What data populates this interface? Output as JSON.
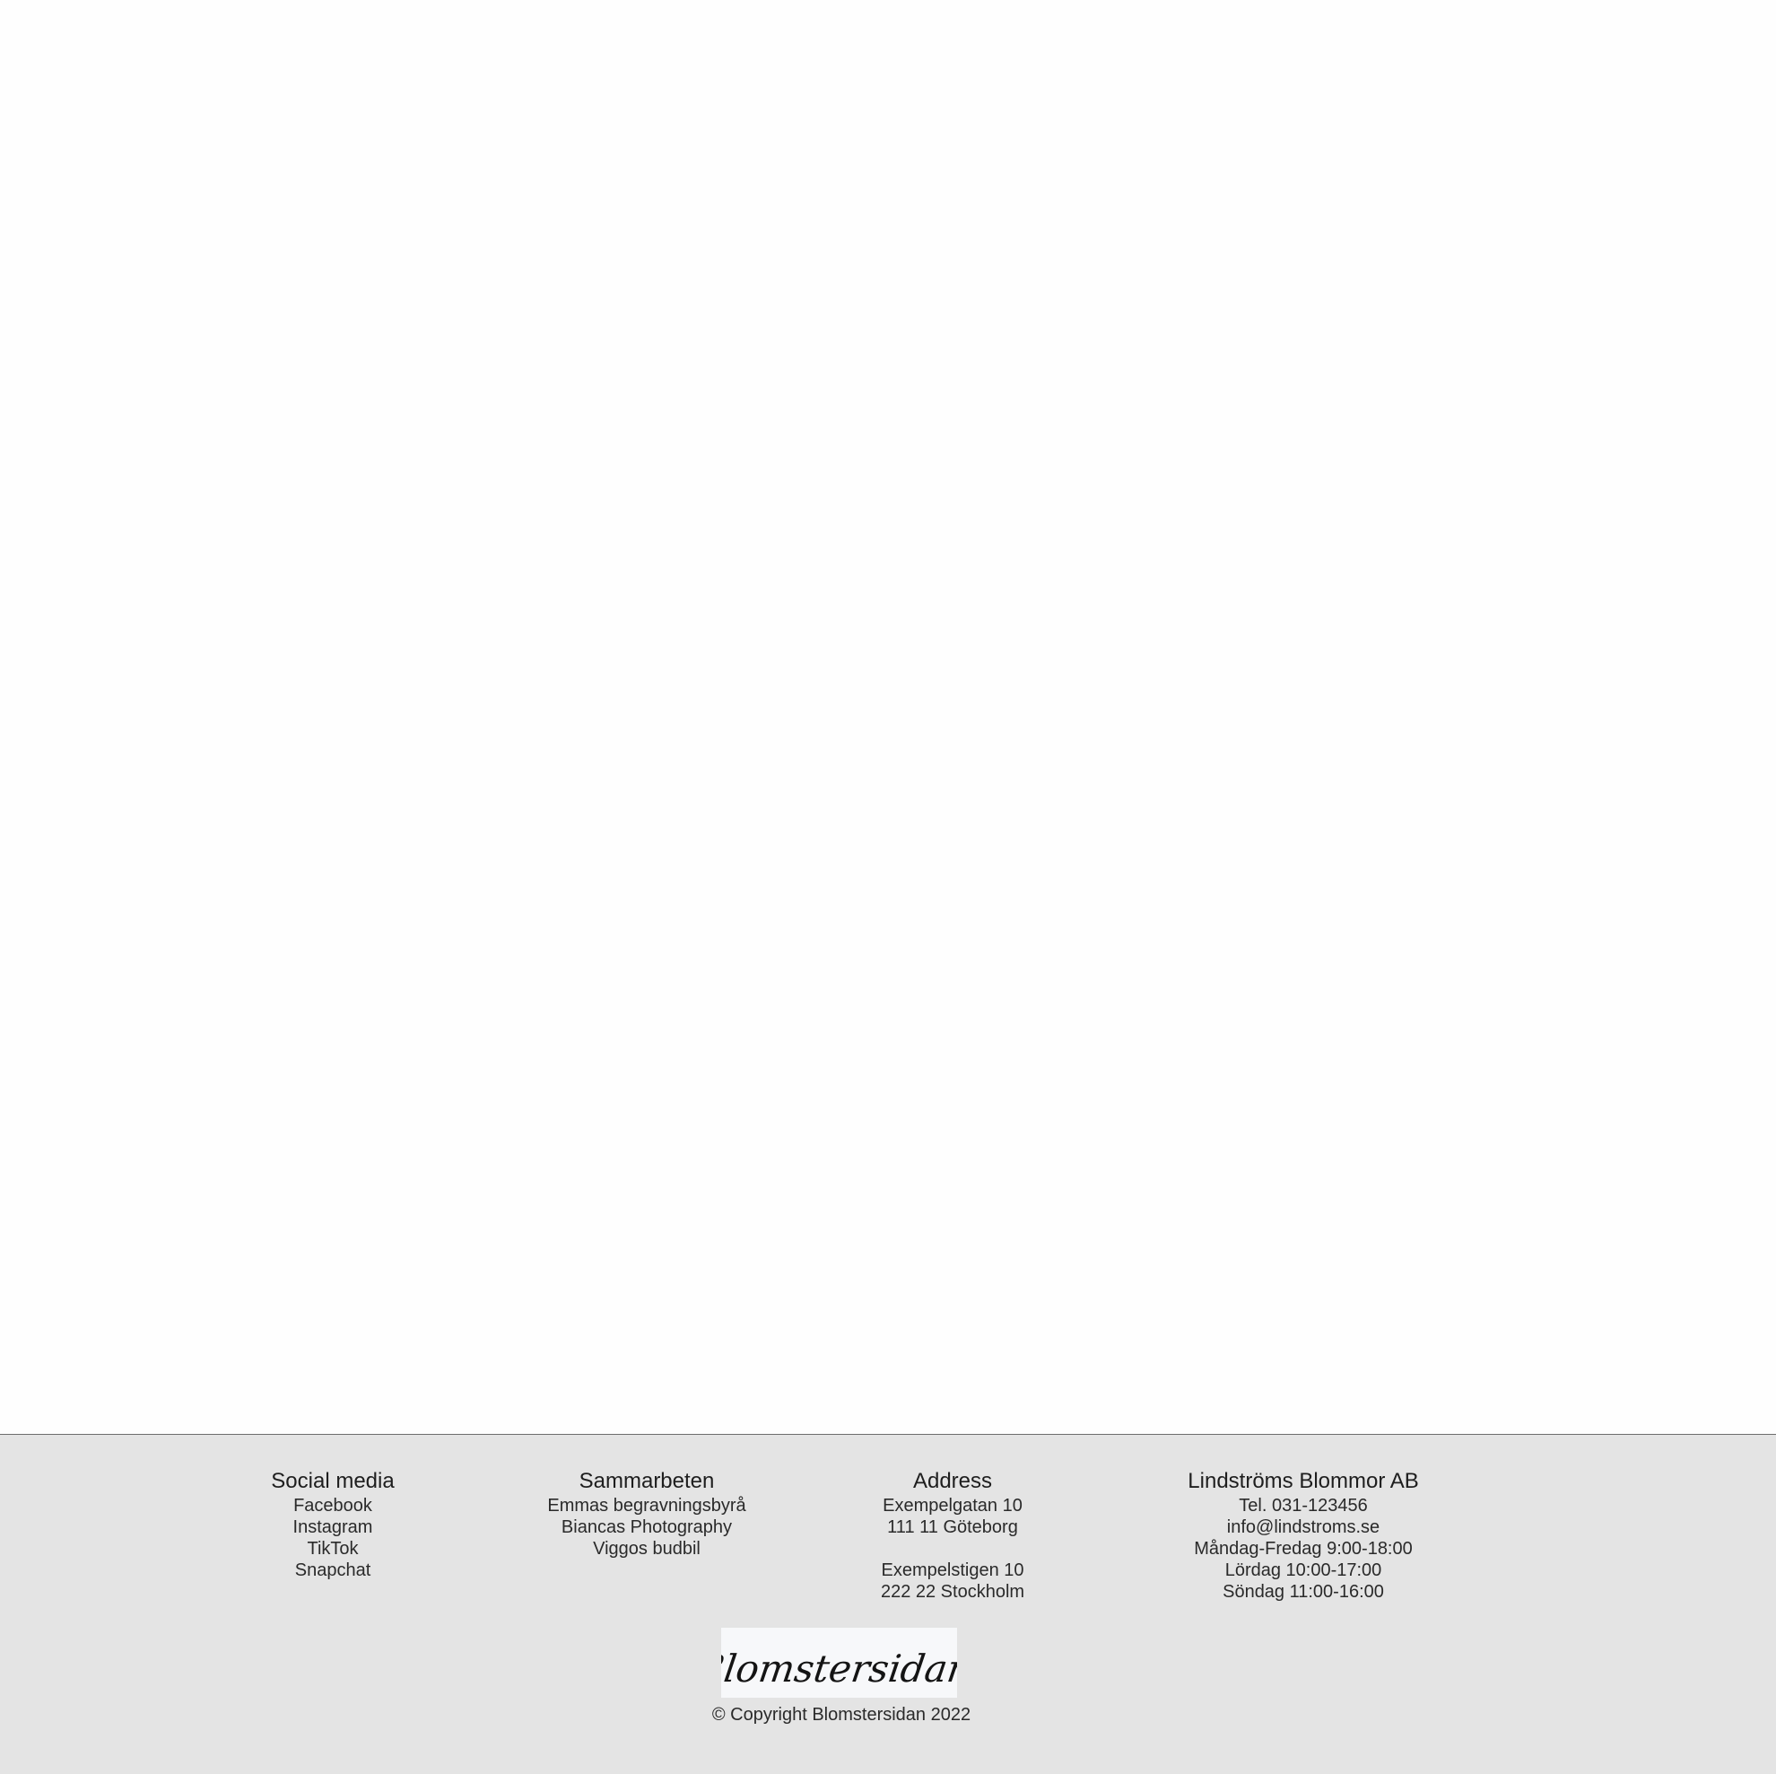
{
  "footer": {
    "social": {
      "heading": "Social media",
      "links": [
        "Facebook",
        "Instagram",
        "TikTok",
        "Snapchat"
      ]
    },
    "collaborations": {
      "heading": "Sammarbeten",
      "links": [
        "Emmas begravningsbyrå",
        "Biancas Photography",
        "Viggos budbil"
      ]
    },
    "address": {
      "heading": "Address",
      "store1": [
        "Exempelgatan 10",
        "111 11 Göteborg"
      ],
      "store2": [
        "Exempelstigen 10",
        "222 22 Stockholm"
      ]
    },
    "company": {
      "heading": "Lindströms Blommor AB",
      "phone": "Tel. 031-123456",
      "email": "info@lindstroms.se",
      "hours": [
        "Måndag-Fredag 9:00-18:00",
        "Lördag 10:00-17:00",
        "Söndag 11:00-16:00"
      ]
    },
    "logo_text": "Blomstersidan.",
    "copyright": "© Copyright Blomstersidan 2022"
  },
  "colors": {
    "page_background": "#fefefe",
    "footer_background": "#e4e4e4",
    "footer_border": "#6d6d6d",
    "text": "#1e1e1e"
  }
}
